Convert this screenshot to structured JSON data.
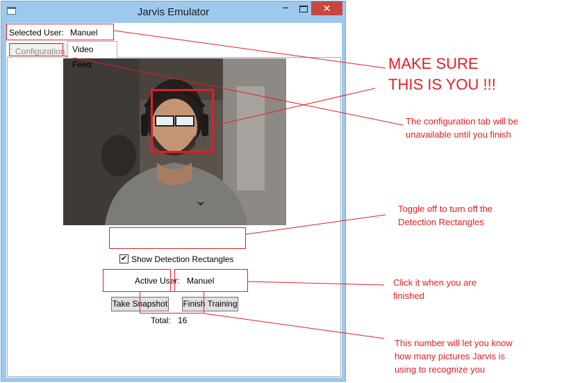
{
  "window": {
    "title": "Jarvis Emulator",
    "minimize_glyph": "‒",
    "close_glyph": "✕"
  },
  "selected_user": {
    "label": "Selected User:",
    "value": "Manuel"
  },
  "tabs": [
    {
      "label": "Configuration",
      "enabled": false
    },
    {
      "label": "Video Feed",
      "active": true
    }
  ],
  "video_feed": {
    "face_detected": true
  },
  "detection": {
    "label": "Show Detection Rectangles",
    "checked": true
  },
  "active_user": {
    "label": "Active User:",
    "value": "Manuel"
  },
  "buttons": {
    "take_snapshot": "Take Snapshot",
    "finish_training": "Finish Training"
  },
  "total": {
    "label": "Total:",
    "value": "16"
  },
  "annotations": {
    "make_sure_line1": "MAKE SURE",
    "make_sure_line2": "THIS IS YOU !!!",
    "config_line1": "The configuration tab will be",
    "config_line2": "unavailable until you finish",
    "toggle_line1": "Toggle off to turn off the",
    "toggle_line2": "Detection Rectangles",
    "click_line1": "Click it when you are",
    "click_line2": "finished",
    "number_line1": "This number will let you know",
    "number_line2": "how many pictures Jarvis is",
    "number_line3": "using to recognize you"
  },
  "colors": {
    "annotation_red": "#e31e24",
    "title_bar": "#9ec9ee",
    "close_button": "#c8473e"
  }
}
